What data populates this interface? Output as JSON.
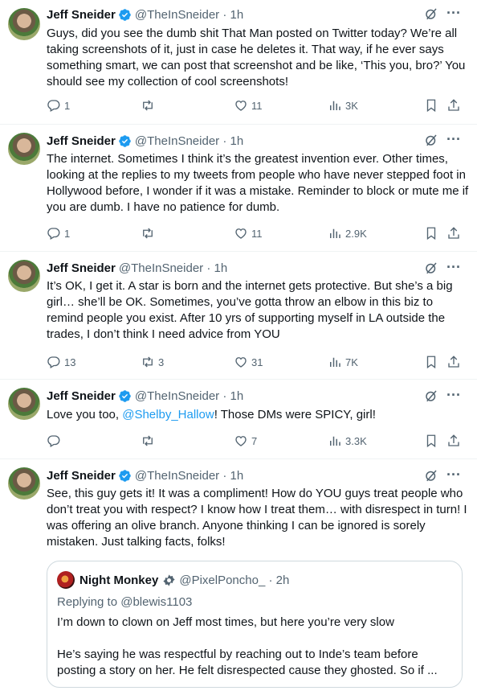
{
  "tweets": [
    {
      "name": "Jeff Sneider",
      "handle": "@TheInSneider · 1h",
      "text": "Guys, did you see the dumb shit That Man posted on Twitter today? We’re all taking screenshots of it, just in case he deletes it. That way, if he ever says something smart, we can post that screenshot and be like, ‘This you, bro?’ You should see my collection of cool screenshots!",
      "replies": "1",
      "reposts": "",
      "likes": "11",
      "views": "3K"
    },
    {
      "name": "Jeff Sneider",
      "handle": "@TheInSneider · 1h",
      "text": "The internet. Sometimes I think it’s the greatest invention ever. Other times, looking at the replies to my tweets from people who have never stepped foot in Hollywood before, I wonder if it was a mistake. Reminder to block or mute me if you are dumb. I have no patience for dumb.",
      "replies": "1",
      "reposts": "",
      "likes": "11",
      "views": "2.9K"
    },
    {
      "name": "Jeff Sneider",
      "handle": "@TheInSneider · 1h",
      "text": "It’s OK, I get it. A star is born and the internet gets protective. But she’s a big girl… she’ll be OK. Sometimes, you’ve gotta throw an elbow in this biz to remind people you exist. After 10 yrs of supporting myself in LA outside the trades, I don’t think I need advice from YOU",
      "replies": "13",
      "reposts": "3",
      "likes": "31",
      "views": "7K"
    },
    {
      "name": "Jeff Sneider",
      "handle": "@TheInSneider · 1h",
      "text_before": "Love you too, ",
      "mention": "@Shelby_Hallow",
      "text_after": "! Those DMs were SPICY, girl!",
      "replies": "",
      "reposts": "",
      "likes": "7",
      "views": "3.3K"
    },
    {
      "name": "Jeff Sneider",
      "handle": "@TheInSneider · 1h",
      "text": "See, this guy gets it! It was a compliment! How do YOU guys treat people who don’t treat you with respect? I know how I treat them… with disrespect in turn! I was offering an olive branch. Anyone thinking I can be ignored is sorely mistaken. Just talking facts, folks!",
      "quote": {
        "name": "Night Monkey",
        "handle": "@PixelPoncho_ · 2h",
        "replying_to": "Replying to @blewis1103",
        "text": "I’m down to clown on Jeff most times, but here you’re very slow\n\nHe’s saying he was respectful by reaching out to Inde’s team before posting a story on her. He felt disrespected cause they ghosted. So if ..."
      }
    }
  ],
  "more_icon": "···",
  "colors": {
    "verified": "#1d9bf0",
    "link": "#1d9bf0",
    "muted": "#536471"
  }
}
